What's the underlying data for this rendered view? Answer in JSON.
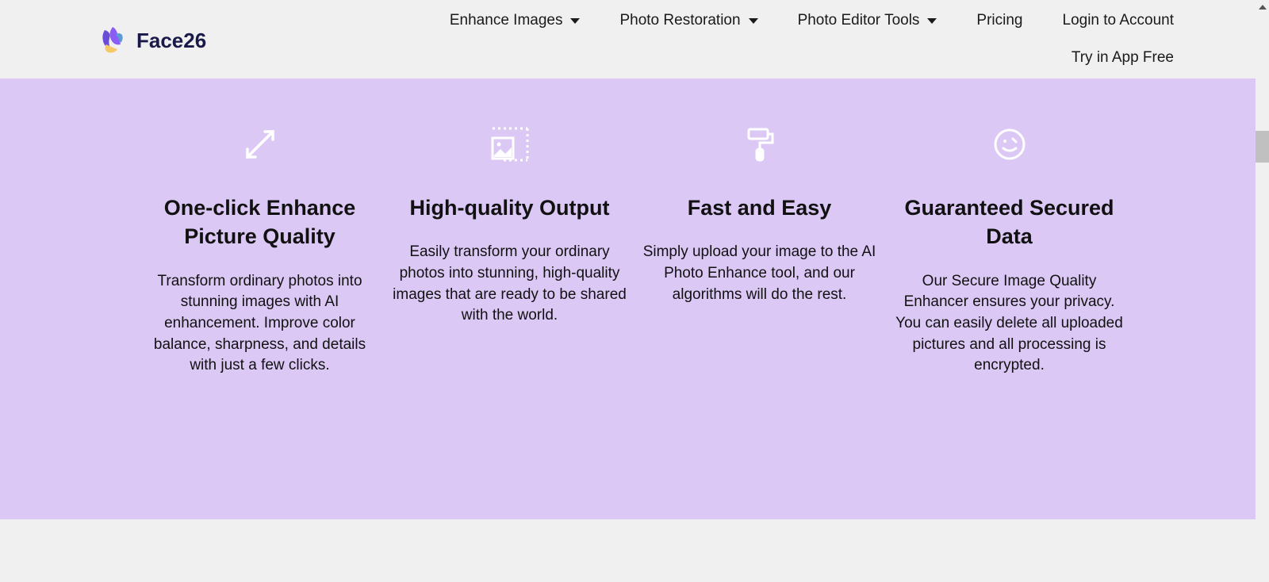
{
  "header": {
    "logo_text": "Face26",
    "nav": {
      "enhance": "Enhance Images",
      "restoration": "Photo Restoration",
      "editor": "Photo Editor Tools",
      "pricing": "Pricing",
      "login": "Login to Account",
      "try_free": "Try in App Free"
    }
  },
  "features": [
    {
      "title": "One-click Enhance Picture Quality",
      "desc": "Transform ordinary photos into stunning images with AI enhancement. Improve color balance, sharpness, and details with just a few clicks."
    },
    {
      "title": "High-quality Output",
      "desc": "Easily transform your ordinary photos into stunning, high-quality images that are ready to be shared with the world."
    },
    {
      "title": "Fast and Easy",
      "desc": "Simply upload your image to the AI Photo Enhance tool, and our algorithms will do the rest."
    },
    {
      "title": "Guaranteed Secured Data",
      "desc": "Our Secure Image Quality Enhancer ensures your privacy. You can easily delete all uploaded pictures and all processing is encrypted."
    }
  ]
}
